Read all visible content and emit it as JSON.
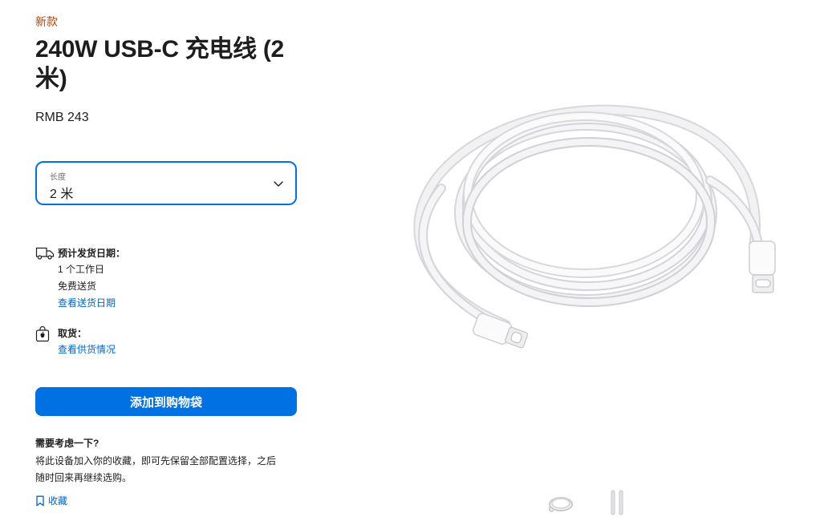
{
  "product": {
    "badge": "新款",
    "title": "240W USB-C 充电线 (2 米)",
    "price": "RMB 243"
  },
  "length_select": {
    "label": "长度",
    "value": "2 米"
  },
  "delivery": {
    "heading": "预计发货日期：",
    "line1": "1 个工作日",
    "line2": "免费送货",
    "link": "查看送货日期"
  },
  "pickup": {
    "heading": "取货：",
    "link": "查看供货情况"
  },
  "actions": {
    "add_to_bag": "添加到购物袋"
  },
  "consider": {
    "heading": "需要考虑一下?",
    "text": "将此设备加入你的收藏，即可先保留全部配置选择，之后随时回来再继续选购。",
    "save_label": "收藏"
  },
  "icons": {
    "delivery": "truck-icon",
    "pickup": "apple-bag-icon",
    "save": "bookmark-icon",
    "select": "chevron-down-icon"
  },
  "colors": {
    "accent": "#0071e3",
    "link": "#0066cc",
    "new_badge": "#b64400"
  }
}
